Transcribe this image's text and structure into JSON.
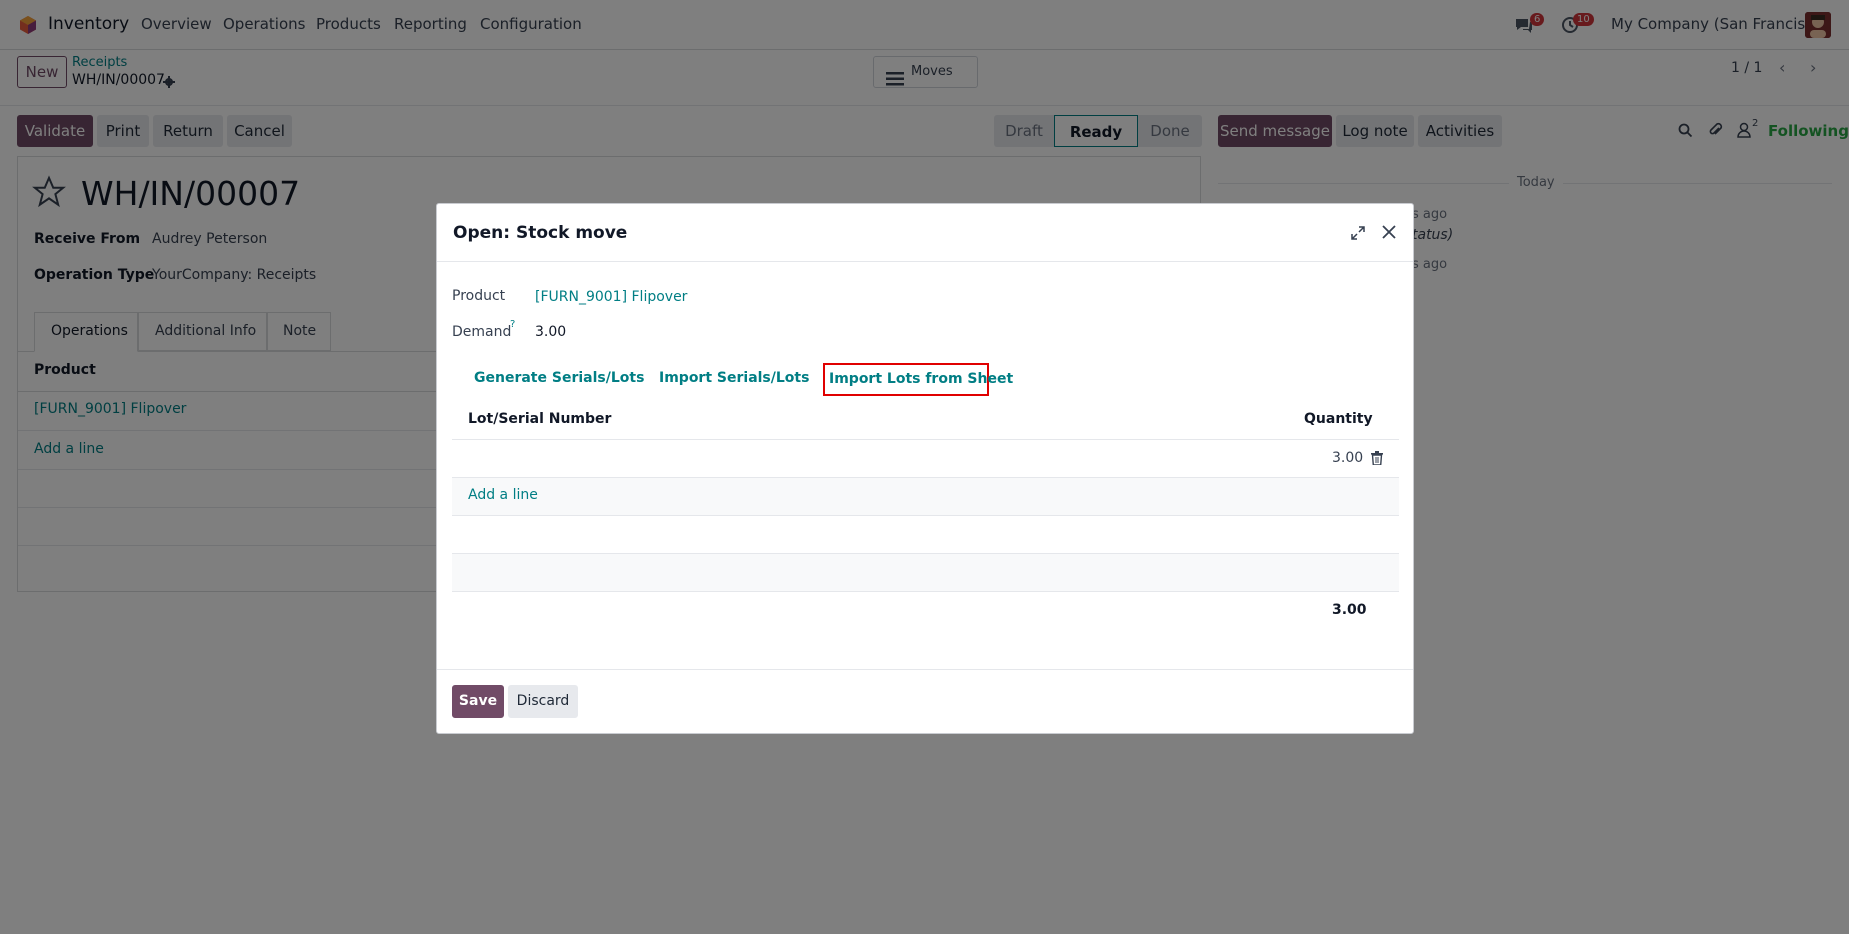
{
  "navbar": {
    "app_name": "Inventory",
    "menu": [
      "Overview",
      "Operations",
      "Products",
      "Reporting",
      "Configuration"
    ],
    "chat_count": "6",
    "activity_count": "10",
    "company": "My Company (San Francisco)"
  },
  "control_panel": {
    "new_label": "New",
    "breadcrumb_parent": "Receipts",
    "record_name": "WH/IN/00007",
    "moves_label": "Moves",
    "pager": "1 / 1"
  },
  "actions": {
    "validate": "Validate",
    "print": "Print",
    "return": "Return",
    "cancel": "Cancel"
  },
  "statusbar": [
    "Draft",
    "Ready",
    "Done"
  ],
  "chatter": {
    "send_message": "Send message",
    "log_note": "Log note",
    "activities": "Activities",
    "followers_count": "2",
    "following": "Following",
    "date_separator": "Today",
    "msg1_time": "s ago",
    "msg1_status": "tatus)",
    "msg2_time": "s ago"
  },
  "form": {
    "title": "WH/IN/00007",
    "receive_from_label": "Receive From",
    "receive_from_value": "Audrey Peterson",
    "operation_type_label": "Operation Type",
    "operation_type_value": "YourCompany: Receipts",
    "tabs": [
      "Operations",
      "Additional Info",
      "Note"
    ],
    "col_product": "Product",
    "row_product": "[FURN_9001] Flipover",
    "add_line": "Add a line"
  },
  "modal": {
    "title": "Open: Stock move",
    "product_label": "Product",
    "product_value": "[FURN_9001] Flipover",
    "demand_label": "Demand",
    "demand_help": "?",
    "demand_value": "3.00",
    "buttons": {
      "generate": "Generate Serials/Lots",
      "import": "Import Serials/Lots",
      "import_sheet": "Import Lots from Sheet"
    },
    "table": {
      "col_lot": "Lot/Serial Number",
      "col_qty": "Quantity",
      "row_qty": "3.00",
      "add_line": "Add a line",
      "total": "3.00"
    },
    "save": "Save",
    "discard": "Discard"
  },
  "colors": {
    "brand": "#714b67",
    "link": "#017e84",
    "badge": "#d0353a",
    "highlight": "#e00000"
  }
}
